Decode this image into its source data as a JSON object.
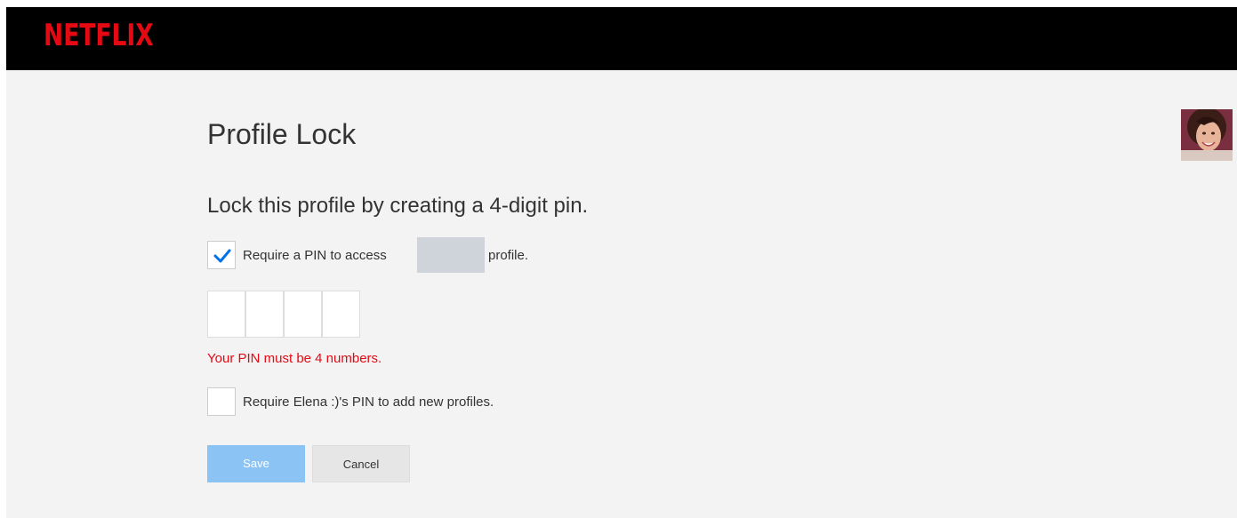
{
  "brand": {
    "logo_text": "NETFLIX",
    "logo_color": "#e50914"
  },
  "page": {
    "title": "Profile Lock",
    "subtitle": "Lock this profile by creating a 4-digit pin."
  },
  "pin_option": {
    "checked": true,
    "label_before": "Require a PIN to access",
    "label_after": "profile."
  },
  "pin_input": {
    "digits": [
      "",
      "",
      "",
      ""
    ]
  },
  "error_message": "Your PIN must be 4 numbers.",
  "error_color": "#e50914",
  "new_profiles_option": {
    "checked": false,
    "label": "Require Elena :)'s PIN to add new profiles."
  },
  "buttons": {
    "save_label": "Save",
    "cancel_label": "Cancel"
  },
  "icons": {
    "checkmark": "checkmark-icon",
    "avatar": "profile-avatar"
  }
}
